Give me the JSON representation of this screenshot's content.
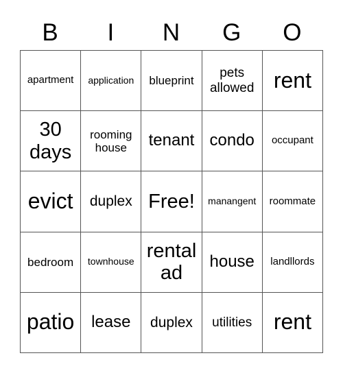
{
  "header": [
    "B",
    "I",
    "N",
    "G",
    "O"
  ],
  "cells": [
    [
      "apartment",
      "application",
      "blueprint",
      "pets allowed",
      "rent"
    ],
    [
      "30 days",
      "rooming house",
      "tenant",
      "condo",
      "occupant"
    ],
    [
      "evict",
      "duplex",
      "Free!",
      "manangent",
      "roommate"
    ],
    [
      "bedroom",
      "townhouse",
      "rental ad",
      "house",
      "landllords"
    ],
    [
      "patio",
      "lease",
      "duplex",
      "utilities",
      "rent"
    ]
  ]
}
